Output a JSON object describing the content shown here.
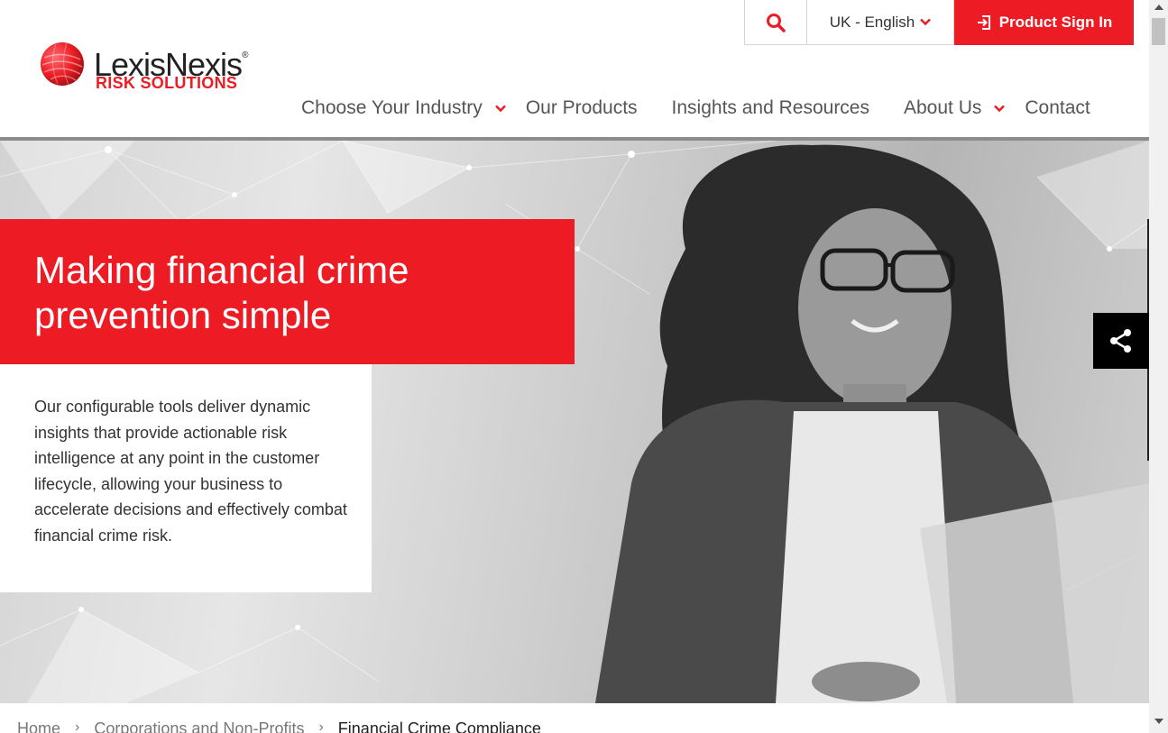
{
  "brand": {
    "name": "LexisNexis",
    "registered": "®",
    "subtitle": "RISK SOLUTIONS",
    "accent_color": "#ed1c24"
  },
  "utility": {
    "search_icon": "search-icon",
    "language": "UK - English",
    "signin_label": "Product Sign In",
    "signin_icon": "sign-in-icon"
  },
  "nav": {
    "items": [
      {
        "label": "Choose Your Industry",
        "dropdown": true
      },
      {
        "label": "Our Products",
        "dropdown": false
      },
      {
        "label": "Insights and Resources",
        "dropdown": false
      },
      {
        "label": "About Us",
        "dropdown": true
      },
      {
        "label": "Contact",
        "dropdown": false
      }
    ]
  },
  "hero": {
    "title": "Making financial crime prevention simple",
    "body": "Our configurable tools deliver dynamic insights that provide actionable risk intelligence at any point in the customer lifecycle, allowing your business to accelerate decisions and effectively combat financial crime risk."
  },
  "share": {
    "icon": "share-icon"
  },
  "breadcrumb": {
    "items": [
      "Home",
      "Corporations and Non-Profits",
      "Financial Crime Compliance"
    ],
    "separator": "›"
  }
}
